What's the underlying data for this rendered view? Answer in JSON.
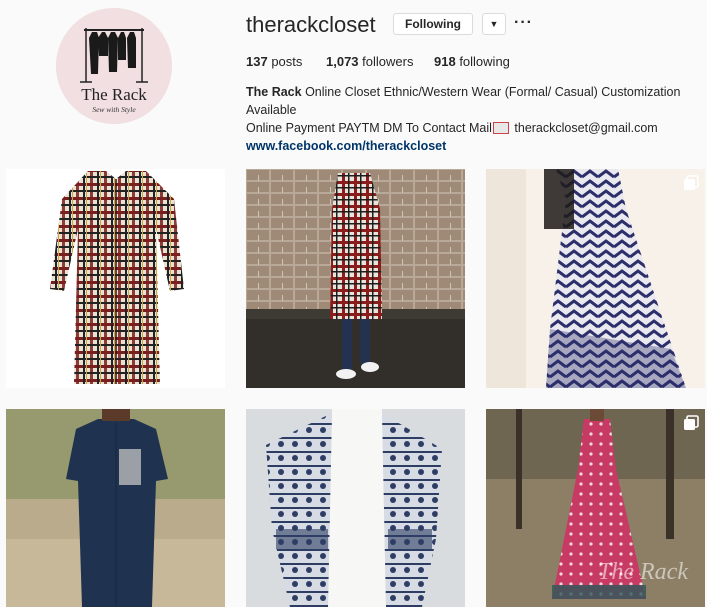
{
  "profile": {
    "username": "therackcloset",
    "avatar_logo": {
      "brand": "The Rack",
      "tagline": "Sew with Style"
    },
    "following_button": "Following",
    "dropdown_icon": "chevron-down-icon",
    "more_icon": "more-options-icon",
    "stats": {
      "posts_count": "137",
      "posts_label": " posts",
      "followers_count": "1,073",
      "followers_label": " followers",
      "following_count": "918",
      "following_label": " following"
    },
    "bio": {
      "name": "The Rack",
      "line1_rest": " Online Closet Ethnic/Western Wear (Formal/ Casual) Customization Available",
      "line2_before_icon": "Online Payment PAYTM DM To Contact Mail",
      "line2_after_icon": " therackcloset@gmail.com",
      "mail_icon": "envelope-emoji-icon",
      "link": "www.facebook.com/therackcloset"
    }
  },
  "grid": {
    "posts": [
      {
        "subject": "plaid shirt dress on white background",
        "multi_photo": false
      },
      {
        "subject": "model in plaid tunic against brick wall",
        "multi_photo": false
      },
      {
        "subject": "chevron print blue white saree on mannequin",
        "multi_photo": true,
        "indicator_icon": "multiple-photos-icon"
      },
      {
        "subject": "navy kurta with grey pocket outdoors",
        "multi_photo": false
      },
      {
        "subject": "white kurta with indigo block print dupatta",
        "multi_photo": false
      },
      {
        "subject": "pink patterned dress in park",
        "multi_photo": true,
        "indicator_icon": "multiple-photos-icon",
        "watermark": "The Rack"
      }
    ]
  },
  "colors": {
    "background": "#fafafa",
    "text": "#262626",
    "link": "#003569",
    "border": "#dbdbdb"
  }
}
